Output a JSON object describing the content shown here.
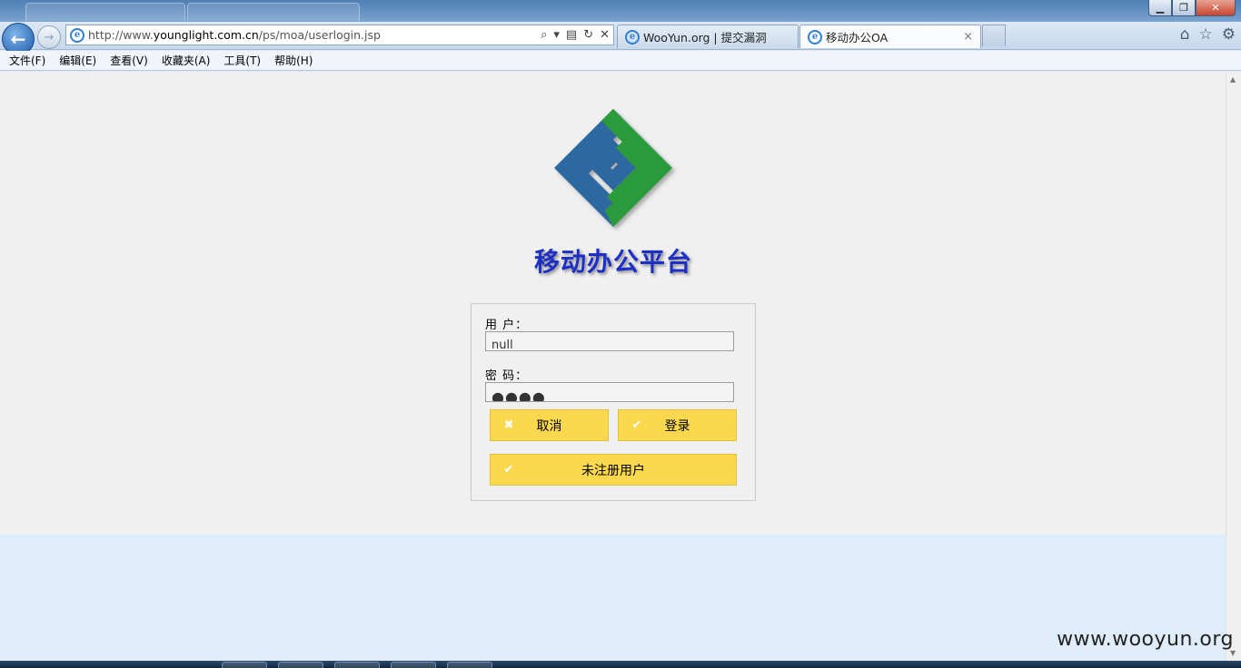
{
  "window": {
    "minimize_label": "▁",
    "maximize_label": "❐",
    "close_label": "✕"
  },
  "navigation": {
    "back_label": "←",
    "forward_label": "→",
    "address": {
      "prefix": "http://www.",
      "host": "younglight.com.cn",
      "path": "/ps/moa/userlogin.jsp"
    },
    "address_tools": [
      "⌕",
      "▾",
      "▤",
      "↻",
      "✕"
    ]
  },
  "tabs": [
    {
      "title": "WooYun.org | 提交漏洞",
      "active": false
    },
    {
      "title": "移动办公OA",
      "active": true,
      "close_label": "×"
    }
  ],
  "toolbar_icons": [
    "home-icon",
    "favorites-star-icon",
    "settings-gear-icon"
  ],
  "toolbar_glyphs": {
    "home": "⌂",
    "star": "☆",
    "gear": "⚙"
  },
  "menubar": [
    "文件(F)",
    "编辑(E)",
    "查看(V)",
    "收藏夹(A)",
    "工具(T)",
    "帮助(H)"
  ],
  "page": {
    "title": "移动办公平台",
    "logo_colors": {
      "blue": "#2f68a0",
      "green": "#2c9a3a"
    },
    "login": {
      "user_label": "用 户：",
      "user_value": "null",
      "password_label": "密 码：",
      "password_value": "●●●●",
      "cancel_icon": "✖",
      "cancel_label": "取消",
      "login_icon": "✔",
      "login_label": "登录",
      "register_icon": "✔",
      "register_label": "未注册用户"
    },
    "button_color": "#fbd84d"
  },
  "watermark": "www.wooyun.org"
}
